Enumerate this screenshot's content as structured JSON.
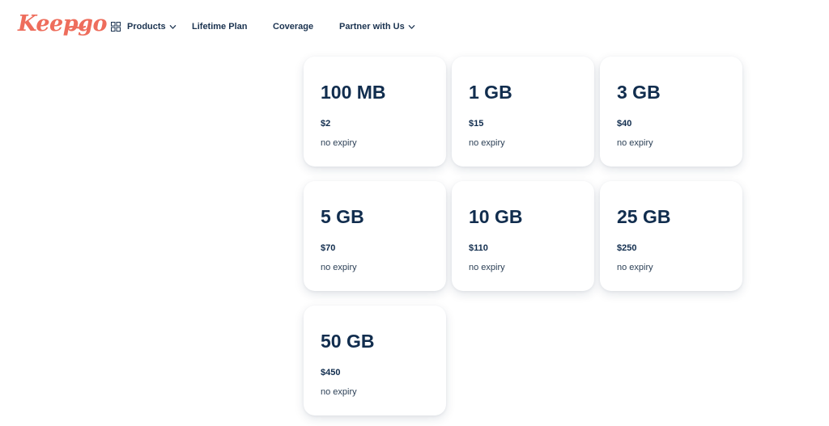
{
  "brand": {
    "logo_text": "Keepgo",
    "logo_color": "#ee6d5c"
  },
  "nav": {
    "products": "Products",
    "lifetime": "Lifetime Plan",
    "coverage": "Coverage",
    "partner": "Partner with Us"
  },
  "plans": [
    {
      "size": "100 MB",
      "price": "$2",
      "expiry": "no expiry"
    },
    {
      "size": "1 GB",
      "price": "$15",
      "expiry": "no expiry"
    },
    {
      "size": "3 GB",
      "price": "$40",
      "expiry": "no expiry"
    },
    {
      "size": "5 GB",
      "price": "$70",
      "expiry": "no expiry"
    },
    {
      "size": "10 GB",
      "price": "$110",
      "expiry": "no expiry"
    },
    {
      "size": "25 GB",
      "price": "$250",
      "expiry": "no expiry"
    },
    {
      "size": "50 GB",
      "price": "$450",
      "expiry": "no expiry"
    }
  ],
  "colors": {
    "text": "#112d4e",
    "accent": "#ee6d5c"
  },
  "icons": {
    "products": "grid-icon",
    "dropdown": "chevron-down-icon"
  }
}
